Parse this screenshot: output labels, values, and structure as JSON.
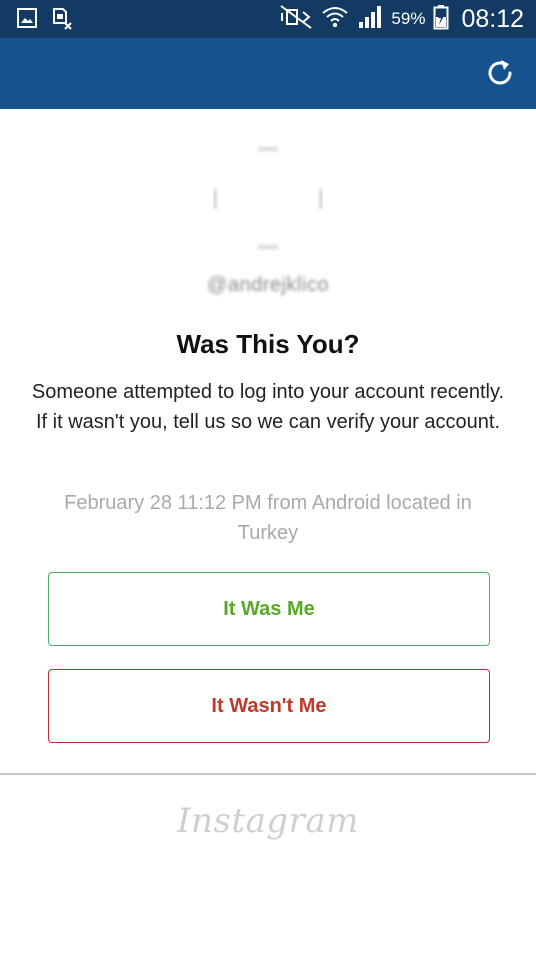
{
  "status_bar": {
    "battery_percent": "59%",
    "time": "08:12",
    "icons": [
      "gallery-icon",
      "sim-icon",
      "mute-icon",
      "wifi-icon",
      "signal-icon",
      "battery-charging-icon"
    ]
  },
  "app_bar": {
    "refresh_icon": "refresh-icon",
    "color": "#16528e"
  },
  "profile": {
    "username": "@andrejklico"
  },
  "dialog": {
    "title": "Was This You?",
    "message": "Someone attempted to log into your account recently. If it wasn't you, tell us so we can verify your account.",
    "attempt_info": "February 28 11:12 PM from Android located in Turkey"
  },
  "actions": {
    "confirm_label": "It Was Me",
    "deny_label": "It Wasn't Me",
    "confirm_color": "#58a82a",
    "deny_color": "#c0392b"
  },
  "footer": {
    "logo_text": "Instagram"
  }
}
